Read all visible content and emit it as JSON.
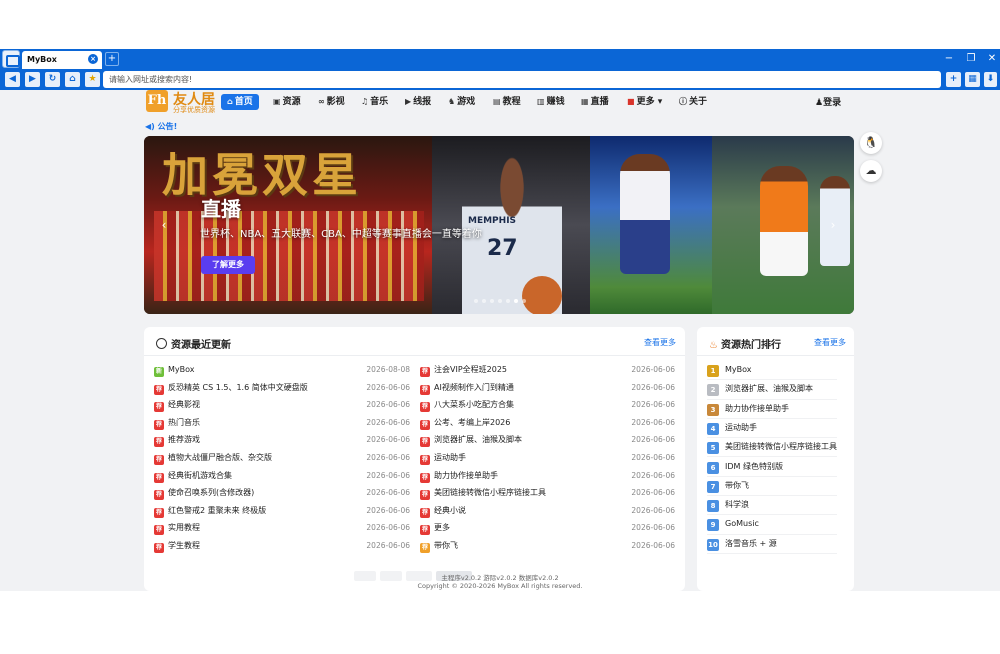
{
  "browser": {
    "tab_title": "MyBox",
    "tab_close": "×",
    "new_tab": "+",
    "url_placeholder": "请输入网址或搜索内容!",
    "min_glyph": "−",
    "restore_glyph": "❐",
    "close_glyph": "✕",
    "back_glyph": "◀",
    "forward_glyph": "▶",
    "reload_glyph": "↻",
    "home_glyph": "⌂",
    "star_glyph": "★",
    "add_glyph": "+",
    "grid_glyph": "▦",
    "download_glyph": "⬇"
  },
  "site": {
    "logo_mark": "Fh",
    "logo_name": "友人居",
    "logo_sub": "分享优质资源",
    "menu": [
      {
        "icon": "⌂",
        "label": "首页"
      },
      {
        "icon": "▣",
        "label": "资源"
      },
      {
        "icon": "∞",
        "label": "影视"
      },
      {
        "icon": "♫",
        "label": "音乐"
      },
      {
        "icon": "▶",
        "label": "线报"
      },
      {
        "icon": "♞",
        "label": "游戏"
      },
      {
        "icon": "▤",
        "label": "教程"
      },
      {
        "icon": "▥",
        "label": "赚钱"
      },
      {
        "icon": "▦",
        "label": "直播"
      },
      {
        "icon": "■",
        "label": "更多 ▾"
      },
      {
        "icon": "ⓘ",
        "label": "关于"
      }
    ],
    "login_icon": "♟",
    "login_label": "登录",
    "notice_icon": "◀)",
    "notice": "公告!"
  },
  "banner": {
    "art_text": "加冕双星",
    "heading": "直播",
    "description": "世界杯、NBA、五大联赛、CBA、中超等赛事直播会一直等着你",
    "more_label": "了解更多",
    "prev": "‹",
    "next": "›",
    "team_text": "MEMPHIS",
    "jersey_number": "27",
    "dot_count": 7
  },
  "floats": {
    "qq_glyph": "🐧",
    "wechat_glyph": "☁"
  },
  "updates": {
    "title": "资源最近更新",
    "more": "查看更多",
    "left": [
      {
        "badge": "新",
        "color": "#6fbf3a",
        "name": "MyBox",
        "date": "2026-08-08"
      },
      {
        "badge": "荐",
        "color": "#e53935",
        "name": "反恐精英 CS 1.5、1.6 简体中文硬盘版",
        "date": "2026-06-06"
      },
      {
        "badge": "荐",
        "color": "#e53935",
        "name": "经典影视",
        "date": "2026-06-06"
      },
      {
        "badge": "荐",
        "color": "#e53935",
        "name": "热门音乐",
        "date": "2026-06-06"
      },
      {
        "badge": "荐",
        "color": "#e53935",
        "name": "推荐游戏",
        "date": "2026-06-06"
      },
      {
        "badge": "荐",
        "color": "#e53935",
        "name": "植物大战僵尸融合版、杂交版",
        "date": "2026-06-06"
      },
      {
        "badge": "荐",
        "color": "#e53935",
        "name": "经典街机游戏合集",
        "date": "2026-06-06"
      },
      {
        "badge": "荐",
        "color": "#e53935",
        "name": "使命召唤系列(含修改器)",
        "date": "2026-06-06"
      },
      {
        "badge": "荐",
        "color": "#e53935",
        "name": "红色警戒2 重聚未来 终极版",
        "date": "2026-06-06"
      },
      {
        "badge": "荐",
        "color": "#e53935",
        "name": "实用教程",
        "date": "2026-06-06"
      },
      {
        "badge": "荐",
        "color": "#e53935",
        "name": "学生教程",
        "date": "2026-06-06"
      }
    ],
    "right": [
      {
        "badge": "荐",
        "color": "#e53935",
        "name": "注会VIP全程班2025",
        "date": "2026-06-06"
      },
      {
        "badge": "荐",
        "color": "#e53935",
        "name": "AI视频制作入门到精通",
        "date": "2026-06-06"
      },
      {
        "badge": "荐",
        "color": "#e53935",
        "name": "八大菜系小吃配方合集",
        "date": "2026-06-06"
      },
      {
        "badge": "荐",
        "color": "#e53935",
        "name": "公考、考编上岸2026",
        "date": "2026-06-06"
      },
      {
        "badge": "荐",
        "color": "#e53935",
        "name": "浏览器扩展、油猴及脚本",
        "date": "2026-06-06"
      },
      {
        "badge": "荐",
        "color": "#e53935",
        "name": "运动助手",
        "date": "2026-06-06"
      },
      {
        "badge": "荐",
        "color": "#e53935",
        "name": "助力协作接单助手",
        "date": "2026-06-06"
      },
      {
        "badge": "荐",
        "color": "#e53935",
        "name": "美团链接转微信小程序链接工具",
        "date": "2026-06-06"
      },
      {
        "badge": "荐",
        "color": "#e53935",
        "name": "经典小说",
        "date": "2026-06-06"
      },
      {
        "badge": "荐",
        "color": "#e53935",
        "name": "更多",
        "date": "2026-06-06"
      },
      {
        "badge": "荐",
        "color": "#f0a02a",
        "name": "带你飞",
        "date": "2026-06-06"
      }
    ]
  },
  "hot": {
    "title": "资源热门排行",
    "more": "查看更多",
    "items": [
      {
        "rank": "1",
        "color": "#d9a21c",
        "name": "MyBox"
      },
      {
        "rank": "2",
        "color": "#b9bcc2",
        "name": "浏览器扩展、油猴及脚本"
      },
      {
        "rank": "3",
        "color": "#c8883a",
        "name": "助力协作接单助手"
      },
      {
        "rank": "4",
        "color": "#4a90e2",
        "name": "运动助手"
      },
      {
        "rank": "5",
        "color": "#4a90e2",
        "name": "美团链接转微信小程序链接工具"
      },
      {
        "rank": "6",
        "color": "#4a90e2",
        "name": "IDM 绿色特别版"
      },
      {
        "rank": "7",
        "color": "#4a90e2",
        "name": "带你飞"
      },
      {
        "rank": "8",
        "color": "#4a90e2",
        "name": "科学浪"
      },
      {
        "rank": "9",
        "color": "#4a90e2",
        "name": "GoMusic"
      },
      {
        "rank": "10",
        "color": "#4a90e2",
        "name": "洛雪音乐 + 源"
      }
    ]
  },
  "footer": {
    "line1": "主程序v2.0.2 游际v2.0.2 数据库v2.0.2",
    "line2": "Copyright © 2020-2026 MyBox All rights reserved."
  }
}
